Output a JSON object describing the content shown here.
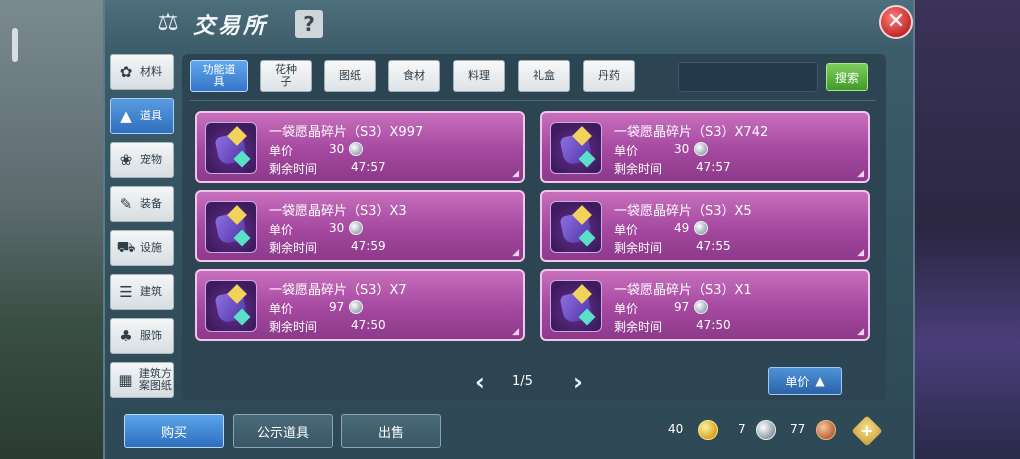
{
  "window": {
    "title": "交易所",
    "help_label": "?",
    "close_label": "✕"
  },
  "sidebar": {
    "items": [
      {
        "label": "材料",
        "icon": "materials-icon",
        "glyph": "✿"
      },
      {
        "label": "道具",
        "icon": "item-icon",
        "glyph": "▲",
        "active": true
      },
      {
        "label": "宠物",
        "icon": "pet-icon",
        "glyph": "❀"
      },
      {
        "label": "装备",
        "icon": "equipment-icon",
        "glyph": "✎"
      },
      {
        "label": "设施",
        "icon": "facility-icon",
        "glyph": "⛟"
      },
      {
        "label": "建筑",
        "icon": "building-icon",
        "glyph": "☰"
      },
      {
        "label": "服饰",
        "icon": "clothing-icon",
        "glyph": "♣"
      },
      {
        "label": "建筑方案图纸",
        "icon": "blueprint-icon",
        "glyph": "▦"
      }
    ]
  },
  "tabs": [
    {
      "label": "功能道具",
      "active": true
    },
    {
      "label": "花种子"
    },
    {
      "label": "图纸"
    },
    {
      "label": "食材"
    },
    {
      "label": "料理"
    },
    {
      "label": "礼盒"
    },
    {
      "label": "丹药"
    }
  ],
  "search": {
    "value": "",
    "placeholder": "",
    "button_label": "搜索"
  },
  "listings": [
    {
      "name": "一袋愿晶碎片（S3）X997",
      "price_label": "单价",
      "price": "30",
      "time_label": "剩余时间",
      "time": "47:57"
    },
    {
      "name": "一袋愿晶碎片（S3）X742",
      "price_label": "单价",
      "price": "30",
      "time_label": "剩余时间",
      "time": "47:57"
    },
    {
      "name": "一袋愿晶碎片（S3）X3",
      "price_label": "单价",
      "price": "30",
      "time_label": "剩余时间",
      "time": "47:59"
    },
    {
      "name": "一袋愿晶碎片（S3）X5",
      "price_label": "单价",
      "price": "49",
      "time_label": "剩余时间",
      "time": "47:55"
    },
    {
      "name": "一袋愿晶碎片（S3）X7",
      "price_label": "单价",
      "price": "97",
      "time_label": "剩余时间",
      "time": "47:50"
    },
    {
      "name": "一袋愿晶碎片（S3）X1",
      "price_label": "单价",
      "price": "97",
      "time_label": "剩余时间",
      "time": "47:50"
    }
  ],
  "pagination": {
    "current": "1/5",
    "prev": "‹",
    "next": "›"
  },
  "sort": {
    "label": "单价",
    "icon": "sort-icon"
  },
  "actions": {
    "buy": "购买",
    "public": "公示道具",
    "sell": "出售"
  },
  "currencies": {
    "gold": "40",
    "silver": "7",
    "bronze": "77",
    "add": "+"
  },
  "colors": {
    "card": "#a548a0",
    "active_tab": "#3376c9",
    "search_button": "#3f9a2b",
    "close": "#c22b2b"
  }
}
